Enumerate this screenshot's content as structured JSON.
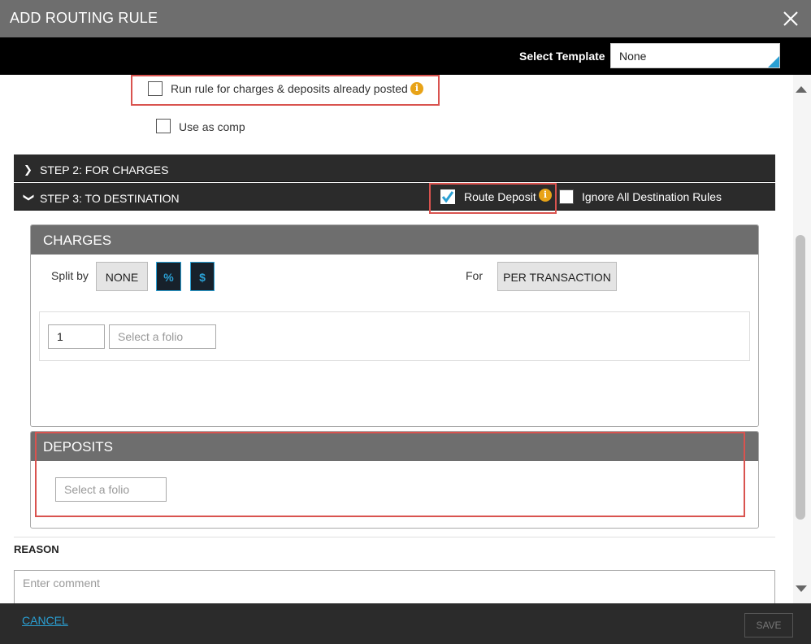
{
  "dialog": {
    "title": "ADD ROUTING RULE"
  },
  "template": {
    "label": "Select Template",
    "value": "None"
  },
  "options": {
    "run_rule_label": "Run rule for charges & deposits already posted",
    "use_as_comp_label": "Use as comp"
  },
  "steps": {
    "step2_label": "STEP 2:  FOR CHARGES",
    "step3_label": "STEP 3:  TO DESTINATION",
    "route_deposit_label": "Route Deposit",
    "ignore_rules_label": "Ignore All Destination Rules"
  },
  "charges": {
    "heading": "CHARGES",
    "split_by_label": "Split by",
    "split_none": "NONE",
    "split_percent": "%",
    "split_dollar": "$",
    "for_label": "For",
    "for_value": "PER TRANSACTION",
    "qty_value": "1",
    "folio_placeholder": "Select a folio"
  },
  "deposits": {
    "heading": "DEPOSITS",
    "folio_placeholder": "Select a folio"
  },
  "reason": {
    "label": "REASON",
    "placeholder": "Enter comment"
  },
  "footer": {
    "cancel_label": "CANCEL",
    "save_label": "SAVE"
  },
  "colors": {
    "accent": "#2aa0d4",
    "highlight": "#d9534f",
    "info": "#e8a317"
  }
}
